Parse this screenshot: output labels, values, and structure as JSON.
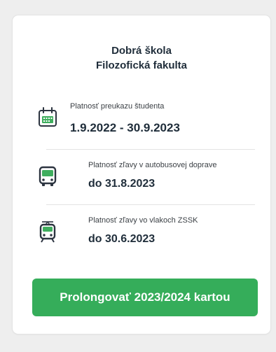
{
  "header": {
    "school_name": "Dobrá škola",
    "faculty_name": "Filozofická fakulta"
  },
  "validity": {
    "student_card": {
      "icon": "calendar-icon",
      "label": "Platnosť preukazu študenta",
      "value": "1.9.2022 - 30.9.2023"
    },
    "bus_discount": {
      "icon": "bus-icon",
      "label": "Platnosť zľavy v autobusovej doprave",
      "value": "do 31.8.2023"
    },
    "train_discount": {
      "icon": "train-icon",
      "label": "Platnosť zľavy vo vlakoch ZSSK",
      "value": "do 30.6.2023"
    }
  },
  "actions": {
    "prolong_label": "Prolongovať 2023/2024 kartou"
  },
  "colors": {
    "accent": "#35ad5a",
    "icon_green": "#3fae5e",
    "text_dark": "#1f2d3a"
  }
}
